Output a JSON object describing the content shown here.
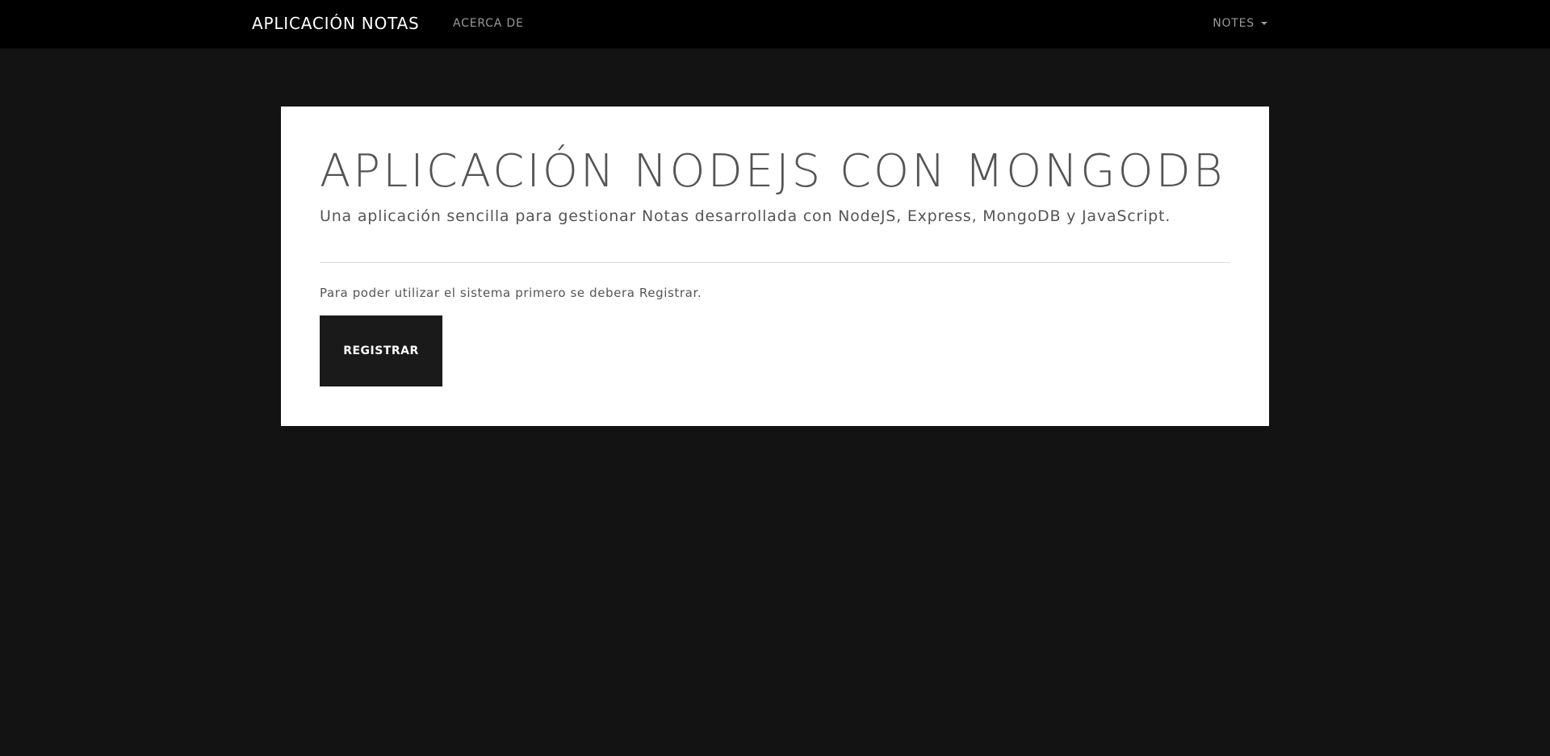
{
  "navbar": {
    "brand": "APLICACIÓN NOTAS",
    "links": [
      {
        "label": "ACERCA DE"
      }
    ],
    "dropdown": {
      "label": "NOTES"
    }
  },
  "jumbotron": {
    "title": "APLICACIÓN NODEJS CON MONGODB",
    "lead": "Una aplicación sencilla para gestionar Notas desarrollada con NodeJS, Express, MongoDB y JavaScript.",
    "info": "Para poder utilizar el sistema primero se debera Registrar.",
    "button_label": "REGISTRAR"
  },
  "colors": {
    "page_background": "#131313",
    "navbar_background": "#000000",
    "card_background": "#ffffff",
    "button_background": "#1a1a1a",
    "text_muted": "#555555"
  }
}
